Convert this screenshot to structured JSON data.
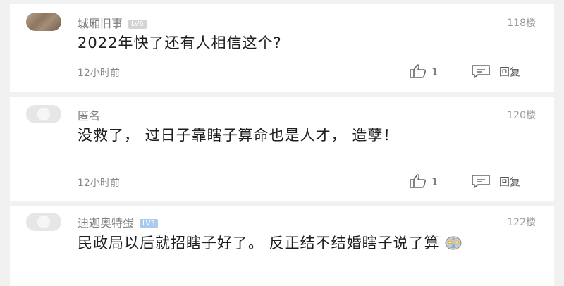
{
  "comments": [
    {
      "username": "城厢旧事",
      "level": "LV6",
      "floor": "118楼",
      "content": "2022年快了还有人相信这个?",
      "time": "12小时前",
      "likes": "1",
      "reply_label": "回复"
    },
    {
      "username": "匿名",
      "floor": "120楼",
      "content": "没救了， 过日子靠瞎子算命也是人才， 造孽！",
      "time": "12小时前",
      "likes": "1",
      "reply_label": "回复"
    },
    {
      "username": "迪迦奥特蛋",
      "level": "LV3",
      "floor": "122楼",
      "content": "民政局以后就招瞎子好了。 反正结不结婚瞎子说了算",
      "emoji": "ultraman-emoji"
    }
  ],
  "colors": {
    "badge_lv6": "#d4d4d4",
    "badge_lv3": "#a9c9ee"
  }
}
